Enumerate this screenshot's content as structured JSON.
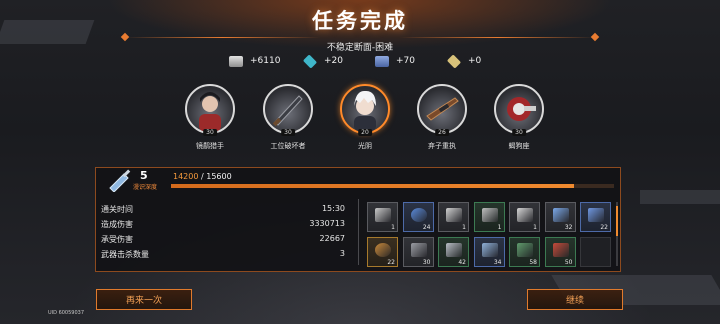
{
  "header": {
    "title": "任务完成",
    "subtitle": "不稳定断面-困难"
  },
  "rewards": [
    {
      "icon": "gold-coin-icon",
      "value": "+6110",
      "color": "#c9c9c9"
    },
    {
      "icon": "cyan-crystal-icon",
      "value": "+20",
      "color": "#3fb6c9"
    },
    {
      "icon": "blue-book-icon",
      "value": "+70",
      "color": "#6b8fd1"
    },
    {
      "icon": "gold-cube-icon",
      "value": "+0",
      "color": "#d8c27a"
    }
  ],
  "characters": [
    {
      "name": "镜鹬猎手",
      "level": "30",
      "active": false
    },
    {
      "name": "工位破坏者",
      "level": "30",
      "active": false
    },
    {
      "name": "光阴",
      "level": "20",
      "active": true
    },
    {
      "name": "弃子重执",
      "level": "26",
      "active": false
    },
    {
      "name": "蝎狗座",
      "level": "30",
      "active": false
    }
  ],
  "exploration": {
    "rank": "5",
    "label": "漫识深度",
    "exp_current": "14200",
    "exp_max": "15600",
    "progress": 0.91
  },
  "stats": [
    {
      "label": "通关时间",
      "value": "15:30"
    },
    {
      "label": "造成伤害",
      "value": "3330713"
    },
    {
      "label": "承受伤害",
      "value": "22667"
    },
    {
      "label": "武器击杀数量",
      "value": "3"
    }
  ],
  "loot": [
    {
      "icon": "cube-box-icon",
      "qty": "1",
      "rarity": "grey"
    },
    {
      "icon": "blue-syringe-icon",
      "qty": "24",
      "rarity": "blue"
    },
    {
      "icon": "rifle-icon",
      "qty": "1",
      "rarity": "grey"
    },
    {
      "icon": "rifle-scope-icon",
      "qty": "1",
      "rarity": "green"
    },
    {
      "icon": "shotgun-icon",
      "qty": "1",
      "rarity": "grey"
    },
    {
      "icon": "blue-canister-icon",
      "qty": "32",
      "rarity": "grey"
    },
    {
      "icon": "blue-gear-icon",
      "qty": "22",
      "rarity": "blue"
    },
    {
      "icon": "bronze-ring-icon",
      "qty": "22",
      "rarity": "gold"
    },
    {
      "icon": "metal-plate-icon",
      "qty": "30",
      "rarity": "grey"
    },
    {
      "icon": "armor-scrap-icon",
      "qty": "42",
      "rarity": "green"
    },
    {
      "icon": "battery-cell-icon",
      "qty": "34",
      "rarity": "blue"
    },
    {
      "icon": "green-chip-icon",
      "qty": "58",
      "rarity": "green"
    },
    {
      "icon": "red-device-icon",
      "qty": "50",
      "rarity": "green"
    },
    {
      "icon": "empty-slot",
      "qty": "",
      "rarity": "empty"
    }
  ],
  "buttons": {
    "retry": "再来一次",
    "continue": "继续"
  },
  "footer": {
    "uid": "UID 60059037"
  }
}
